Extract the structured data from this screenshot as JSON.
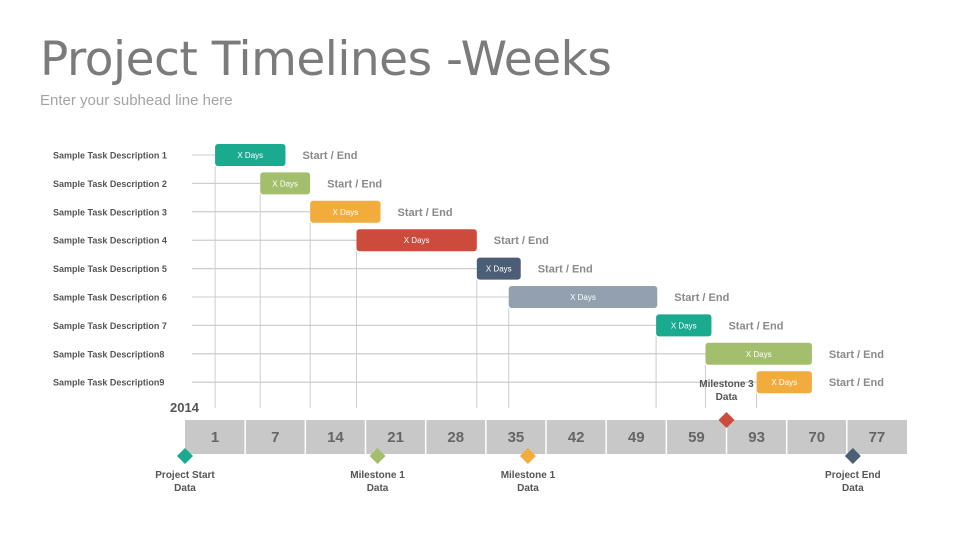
{
  "header": {
    "title": "Project Timelines -Weeks",
    "subtitle": "Enter your subhead line here"
  },
  "chart_data": {
    "type": "gantt",
    "title": "Project Timelines -Weeks",
    "subtitle": "Enter your subhead line here",
    "year": "2014",
    "grid": true,
    "timeline_ticks": [
      "1",
      "7",
      "14",
      "21",
      "28",
      "35",
      "42",
      "49",
      "59",
      "93",
      "70",
      "77"
    ],
    "tasks": [
      {
        "label": "Sample Task Description 1",
        "bar_text": "X Days",
        "end_text": "Start / End",
        "start": 0.5,
        "end": 1.67,
        "color": "#1aaa90"
      },
      {
        "label": "Sample Task Description 2",
        "bar_text": "X Days",
        "end_text": "Start / End",
        "start": 1.25,
        "end": 2.08,
        "color": "#a3bf6e"
      },
      {
        "label": "Sample Task Description 3",
        "bar_text": "X Days",
        "end_text": "Start / End",
        "start": 2.08,
        "end": 3.25,
        "color": "#f2ac3d"
      },
      {
        "label": "Sample Task Description 4",
        "bar_text": "X Days",
        "end_text": "Start / End",
        "start": 2.85,
        "end": 4.85,
        "color": "#cc4b3c"
      },
      {
        "label": "Sample Task Description 5",
        "bar_text": "X Days",
        "end_text": "Start / End",
        "start": 4.85,
        "end": 5.58,
        "color": "#4b5e75"
      },
      {
        "label": "Sample Task Description 6",
        "bar_text": "X Days",
        "end_text": "Start / End",
        "start": 5.38,
        "end": 7.85,
        "color": "#92a0b0"
      },
      {
        "label": "Sample Task Description 7",
        "bar_text": "X Days",
        "end_text": "Start / End",
        "start": 7.83,
        "end": 8.75,
        "color": "#1aaa90"
      },
      {
        "label": "Sample Task Description8",
        "bar_text": "X Days",
        "end_text": "Start / End",
        "start": 8.65,
        "end": 10.42,
        "color": "#a3bf6e"
      },
      {
        "label": "Sample Task Description9",
        "bar_text": "X Days",
        "end_text": "Start / End",
        "start": 9.5,
        "end": 10.42,
        "color": "#f2ac3d"
      }
    ],
    "milestones": [
      {
        "label_line1": "Project Start",
        "label_line2": "Data",
        "position": 0.0,
        "side": "below",
        "color": "#1aaa90"
      },
      {
        "label_line1": "Milestone 1",
        "label_line2": "Data",
        "position": 3.2,
        "side": "below",
        "color": "#a3bf6e"
      },
      {
        "label_line1": "Milestone 1",
        "label_line2": "Data",
        "position": 5.7,
        "side": "below",
        "color": "#f2ac3d"
      },
      {
        "label_line1": "Milestone 3",
        "label_line2": "Data",
        "position": 9.0,
        "side": "above",
        "color": "#cc4b3c"
      },
      {
        "label_line1": "Project End",
        "label_line2": "Data",
        "position": 11.1,
        "side": "below",
        "color": "#4b5e75"
      }
    ],
    "colors": {
      "timeline_fill": "#c8c8c8",
      "grid": "#cccccc"
    }
  }
}
